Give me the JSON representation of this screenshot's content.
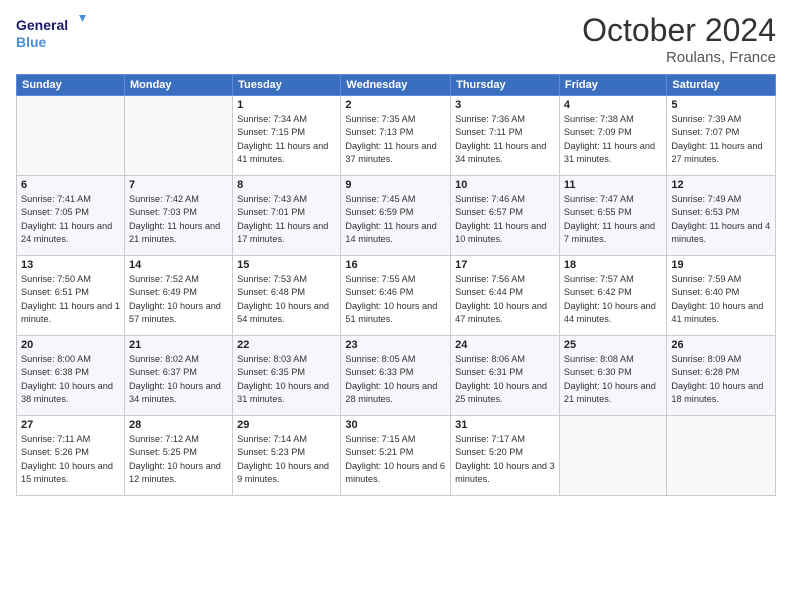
{
  "header": {
    "logo_line1": "General",
    "logo_line2": "Blue",
    "month": "October 2024",
    "location": "Roulans, France"
  },
  "weekdays": [
    "Sunday",
    "Monday",
    "Tuesday",
    "Wednesday",
    "Thursday",
    "Friday",
    "Saturday"
  ],
  "weeks": [
    [
      {
        "day": "",
        "info": ""
      },
      {
        "day": "",
        "info": ""
      },
      {
        "day": "1",
        "info": "Sunrise: 7:34 AM\nSunset: 7:15 PM\nDaylight: 11 hours and 41 minutes."
      },
      {
        "day": "2",
        "info": "Sunrise: 7:35 AM\nSunset: 7:13 PM\nDaylight: 11 hours and 37 minutes."
      },
      {
        "day": "3",
        "info": "Sunrise: 7:36 AM\nSunset: 7:11 PM\nDaylight: 11 hours and 34 minutes."
      },
      {
        "day": "4",
        "info": "Sunrise: 7:38 AM\nSunset: 7:09 PM\nDaylight: 11 hours and 31 minutes."
      },
      {
        "day": "5",
        "info": "Sunrise: 7:39 AM\nSunset: 7:07 PM\nDaylight: 11 hours and 27 minutes."
      }
    ],
    [
      {
        "day": "6",
        "info": "Sunrise: 7:41 AM\nSunset: 7:05 PM\nDaylight: 11 hours and 24 minutes."
      },
      {
        "day": "7",
        "info": "Sunrise: 7:42 AM\nSunset: 7:03 PM\nDaylight: 11 hours and 21 minutes."
      },
      {
        "day": "8",
        "info": "Sunrise: 7:43 AM\nSunset: 7:01 PM\nDaylight: 11 hours and 17 minutes."
      },
      {
        "day": "9",
        "info": "Sunrise: 7:45 AM\nSunset: 6:59 PM\nDaylight: 11 hours and 14 minutes."
      },
      {
        "day": "10",
        "info": "Sunrise: 7:46 AM\nSunset: 6:57 PM\nDaylight: 11 hours and 10 minutes."
      },
      {
        "day": "11",
        "info": "Sunrise: 7:47 AM\nSunset: 6:55 PM\nDaylight: 11 hours and 7 minutes."
      },
      {
        "day": "12",
        "info": "Sunrise: 7:49 AM\nSunset: 6:53 PM\nDaylight: 11 hours and 4 minutes."
      }
    ],
    [
      {
        "day": "13",
        "info": "Sunrise: 7:50 AM\nSunset: 6:51 PM\nDaylight: 11 hours and 1 minute."
      },
      {
        "day": "14",
        "info": "Sunrise: 7:52 AM\nSunset: 6:49 PM\nDaylight: 10 hours and 57 minutes."
      },
      {
        "day": "15",
        "info": "Sunrise: 7:53 AM\nSunset: 6:48 PM\nDaylight: 10 hours and 54 minutes."
      },
      {
        "day": "16",
        "info": "Sunrise: 7:55 AM\nSunset: 6:46 PM\nDaylight: 10 hours and 51 minutes."
      },
      {
        "day": "17",
        "info": "Sunrise: 7:56 AM\nSunset: 6:44 PM\nDaylight: 10 hours and 47 minutes."
      },
      {
        "day": "18",
        "info": "Sunrise: 7:57 AM\nSunset: 6:42 PM\nDaylight: 10 hours and 44 minutes."
      },
      {
        "day": "19",
        "info": "Sunrise: 7:59 AM\nSunset: 6:40 PM\nDaylight: 10 hours and 41 minutes."
      }
    ],
    [
      {
        "day": "20",
        "info": "Sunrise: 8:00 AM\nSunset: 6:38 PM\nDaylight: 10 hours and 38 minutes."
      },
      {
        "day": "21",
        "info": "Sunrise: 8:02 AM\nSunset: 6:37 PM\nDaylight: 10 hours and 34 minutes."
      },
      {
        "day": "22",
        "info": "Sunrise: 8:03 AM\nSunset: 6:35 PM\nDaylight: 10 hours and 31 minutes."
      },
      {
        "day": "23",
        "info": "Sunrise: 8:05 AM\nSunset: 6:33 PM\nDaylight: 10 hours and 28 minutes."
      },
      {
        "day": "24",
        "info": "Sunrise: 8:06 AM\nSunset: 6:31 PM\nDaylight: 10 hours and 25 minutes."
      },
      {
        "day": "25",
        "info": "Sunrise: 8:08 AM\nSunset: 6:30 PM\nDaylight: 10 hours and 21 minutes."
      },
      {
        "day": "26",
        "info": "Sunrise: 8:09 AM\nSunset: 6:28 PM\nDaylight: 10 hours and 18 minutes."
      }
    ],
    [
      {
        "day": "27",
        "info": "Sunrise: 7:11 AM\nSunset: 5:26 PM\nDaylight: 10 hours and 15 minutes."
      },
      {
        "day": "28",
        "info": "Sunrise: 7:12 AM\nSunset: 5:25 PM\nDaylight: 10 hours and 12 minutes."
      },
      {
        "day": "29",
        "info": "Sunrise: 7:14 AM\nSunset: 5:23 PM\nDaylight: 10 hours and 9 minutes."
      },
      {
        "day": "30",
        "info": "Sunrise: 7:15 AM\nSunset: 5:21 PM\nDaylight: 10 hours and 6 minutes."
      },
      {
        "day": "31",
        "info": "Sunrise: 7:17 AM\nSunset: 5:20 PM\nDaylight: 10 hours and 3 minutes."
      },
      {
        "day": "",
        "info": ""
      },
      {
        "day": "",
        "info": ""
      }
    ]
  ]
}
